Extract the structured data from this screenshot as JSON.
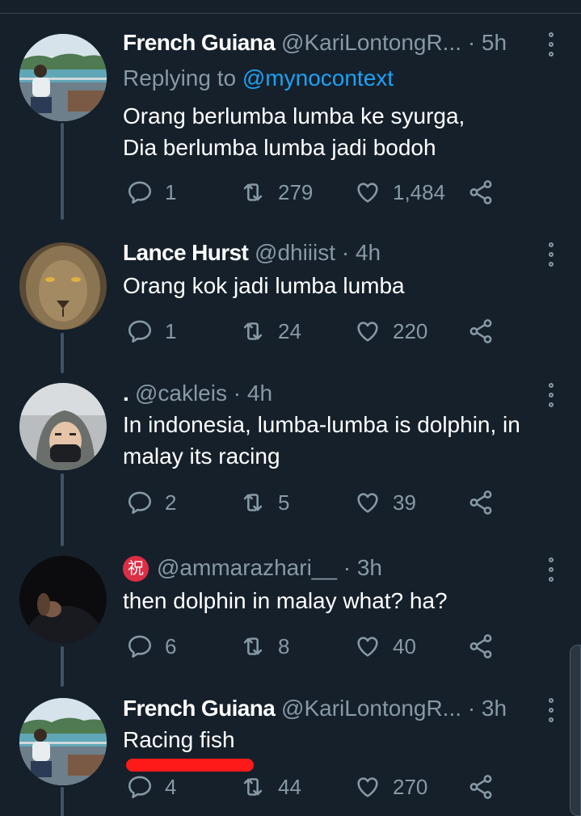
{
  "tweets": [
    {
      "name": "French Guiana",
      "handle": "@KariLontongR...",
      "dot": "·",
      "time": "5h",
      "replying_prefix": "Replying to ",
      "replying_to": "@mynocontext",
      "lines": [
        "Orang berlumba lumba ke syurga,",
        "Dia berlumba lumba jadi bodoh"
      ],
      "replies": "1",
      "retweets": "279",
      "likes": "1,484"
    },
    {
      "name": "Lance Hurst",
      "handle": "@dhiiist",
      "dot": "·",
      "time": "4h",
      "lines": [
        "Orang kok jadi lumba lumba"
      ],
      "replies": "1",
      "retweets": "24",
      "likes": "220"
    },
    {
      "name": ".",
      "handle": "@cakleis",
      "dot": "·",
      "time": "4h",
      "lines": [
        "In indonesia, lumba-lumba is dolphin, in",
        "malay its racing"
      ],
      "replies": "2",
      "retweets": "5",
      "likes": "39"
    },
    {
      "name": "祝",
      "handle": "@ammarazhari__",
      "dot": "·",
      "time": "3h",
      "lines": [
        "then dolphin in malay what? ha?"
      ],
      "replies": "6",
      "retweets": "8",
      "likes": "40"
    },
    {
      "name": "French Guiana",
      "handle": "@KariLontongR...",
      "dot": "·",
      "time": "3h",
      "lines": [
        "Racing fish"
      ],
      "replies": "4",
      "retweets": "44",
      "likes": "270"
    }
  ],
  "colors": {
    "background": "#15202b",
    "secondary_text": "#8899a6",
    "link": "#1da1f2",
    "highlight_mark": "#ff1a1a"
  },
  "icons": [
    "reply-icon",
    "retweet-icon",
    "like-icon",
    "share-icon",
    "more-options-icon"
  ]
}
